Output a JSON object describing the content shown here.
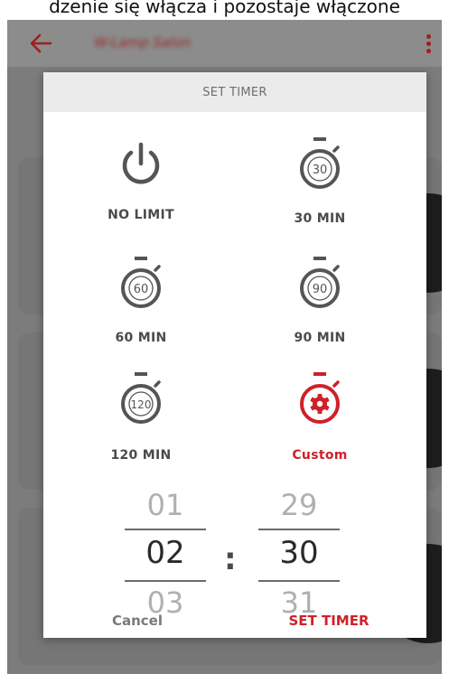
{
  "caption": "dzenie się włącza i pozostaje włączone",
  "appbar": {
    "title": "W-Lamp Salon"
  },
  "dialog": {
    "title": "SET TIMER",
    "options": [
      {
        "label": "NO LIMIT",
        "icon": "power-icon"
      },
      {
        "label": "30 MIN",
        "icon": "stopwatch-icon",
        "badge": "30"
      },
      {
        "label": "60 MIN",
        "icon": "stopwatch-icon",
        "badge": "60"
      },
      {
        "label": "90 MIN",
        "icon": "stopwatch-icon",
        "badge": "90"
      },
      {
        "label": "120 MIN",
        "icon": "stopwatch-icon",
        "badge": "120"
      },
      {
        "label": "Custom",
        "icon": "stopwatch-gear-icon"
      }
    ],
    "picker": {
      "hours": {
        "prev": "01",
        "value": "02",
        "next": "03"
      },
      "minutes": {
        "prev": "29",
        "value": "30",
        "next": "31"
      },
      "separator": ":"
    },
    "cancel_label": "Cancel",
    "confirm_label": "SET TIMER"
  },
  "colors": {
    "accent": "#d0202a",
    "icon_gray": "#555555",
    "overlay": "#7c7c7c"
  }
}
